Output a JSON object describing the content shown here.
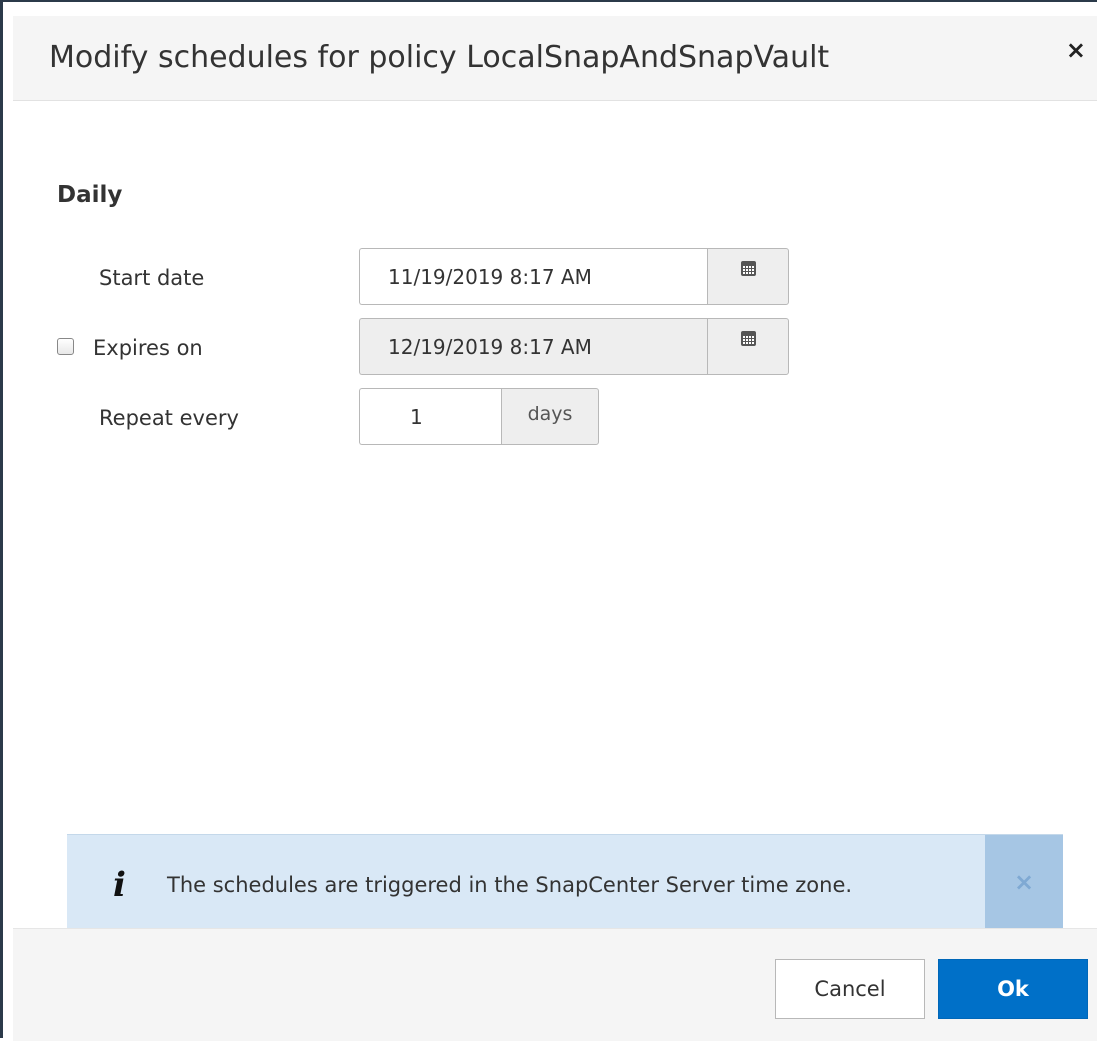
{
  "dialog": {
    "title": "Modify schedules for policy LocalSnapAndSnapVault",
    "close_icon": "×"
  },
  "schedule": {
    "section_title": "Daily",
    "start_date": {
      "label": "Start date",
      "value": "11/19/2019 8:17 AM",
      "icon": "calendar-icon"
    },
    "expires_on": {
      "label": "Expires on",
      "value": "12/19/2019 8:17 AM",
      "checked": false,
      "icon": "calendar-icon"
    },
    "repeat_every": {
      "label": "Repeat every",
      "value": "1",
      "unit": "days"
    }
  },
  "info": {
    "icon": "i",
    "message": "The schedules are triggered in the SnapCenter Server time zone.",
    "close_icon": "×"
  },
  "footer": {
    "cancel_label": "Cancel",
    "ok_label": "Ok"
  },
  "colors": {
    "primary": "#0070c8",
    "info_bg": "#d9e8f6",
    "info_close_bg": "#a6c6e4"
  }
}
